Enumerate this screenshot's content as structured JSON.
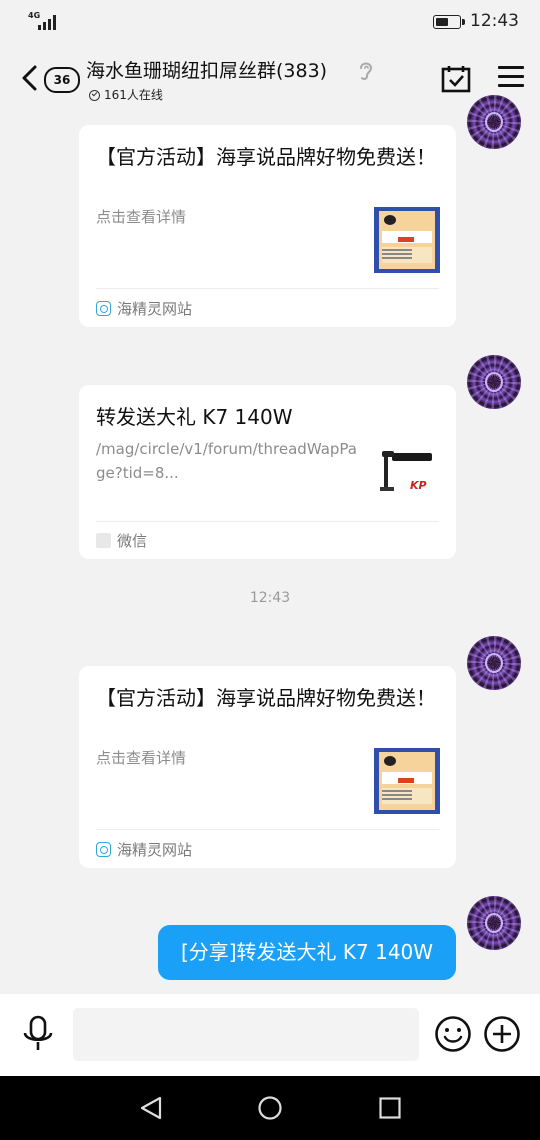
{
  "status_bar": {
    "network": "4G",
    "time": "12:43",
    "battery_level": 0.55
  },
  "header": {
    "unread_count": "36",
    "title": "海水鱼珊瑚纽扣屌丝群(383)",
    "online_text": "161人在线"
  },
  "messages": [
    {
      "type": "link_card",
      "title": "【官方活动】海享说品牌好物免费送！",
      "description": "点击查看详情",
      "source": "海精灵网站",
      "thumb_icon": "promo-poster-thumbnail"
    },
    {
      "type": "link_card",
      "title": "转发送大礼 K7 140W",
      "description": "/mag/circle/v1/forum/threadWapPage?tid=8...",
      "source": "微信",
      "thumb_icon": "aquarium-light-thumbnail",
      "thumb_caption": "KP"
    },
    {
      "type": "timestamp",
      "text": "12:43"
    },
    {
      "type": "link_card",
      "title": "【官方活动】海享说品牌好物免费送！",
      "description": "点击查看详情",
      "source": "海精灵网站",
      "thumb_icon": "promo-poster-thumbnail"
    },
    {
      "type": "text",
      "text": "[分享]转发送大礼 K7 140W"
    }
  ],
  "input": {
    "placeholder": ""
  },
  "colors": {
    "bubble": "#1aa0f6",
    "background": "#f2f2f2"
  }
}
